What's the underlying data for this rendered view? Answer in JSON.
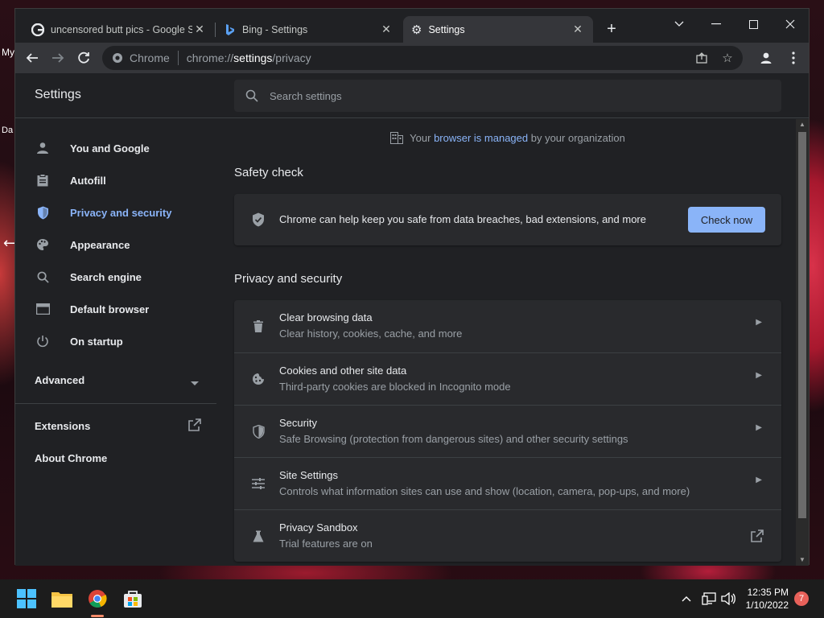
{
  "desktop": {
    "fragments": [
      "My",
      "Da"
    ]
  },
  "tabs": [
    {
      "title": "uncensored butt pics - Google S",
      "icon": "google-icon"
    },
    {
      "title": "Bing - Settings",
      "icon": "bing-icon"
    },
    {
      "title": "Settings",
      "icon": "gear-icon",
      "active": true
    }
  ],
  "toolbar": {
    "chip": "Chrome",
    "url_scheme": "chrome://",
    "url_host": "settings",
    "url_path": "/privacy"
  },
  "settings": {
    "title": "Settings",
    "search_placeholder": "Search settings",
    "nav": [
      {
        "label": "You and Google",
        "icon": "person-icon"
      },
      {
        "label": "Autofill",
        "icon": "clipboard-icon"
      },
      {
        "label": "Privacy and security",
        "icon": "shield-icon",
        "active": true
      },
      {
        "label": "Appearance",
        "icon": "palette-icon"
      },
      {
        "label": "Search engine",
        "icon": "search-icon"
      },
      {
        "label": "Default browser",
        "icon": "browser-icon"
      },
      {
        "label": "On startup",
        "icon": "power-icon"
      }
    ],
    "advanced": "Advanced",
    "extensions": "Extensions",
    "about": "About Chrome",
    "managed": {
      "pre": "Your ",
      "link": "browser is managed",
      "post": " by your organization"
    },
    "safety_check": {
      "title": "Safety check",
      "text": "Chrome can help keep you safe from data breaches, bad extensions, and more",
      "button": "Check now"
    },
    "privacy": {
      "title": "Privacy and security",
      "rows": [
        {
          "title": "Clear browsing data",
          "sub": "Clear history, cookies, cache, and more",
          "icon": "trash-icon"
        },
        {
          "title": "Cookies and other site data",
          "sub": "Third-party cookies are blocked in Incognito mode",
          "icon": "cookie-icon"
        },
        {
          "title": "Security",
          "sub": "Safe Browsing (protection from dangerous sites) and other security settings",
          "icon": "shield-icon"
        },
        {
          "title": "Site Settings",
          "sub": "Controls what information sites can use and show (location, camera, pop-ups, and more)",
          "icon": "sliders-icon"
        },
        {
          "title": "Privacy Sandbox",
          "sub": "Trial features are on",
          "icon": "flask-icon"
        }
      ]
    }
  },
  "taskbar": {
    "time": "12:35 PM",
    "date": "1/10/2022",
    "notifications": "7"
  },
  "colors": {
    "accent": "#8ab4f8",
    "page_bg": "#202124",
    "card_bg": "#292a2d"
  }
}
